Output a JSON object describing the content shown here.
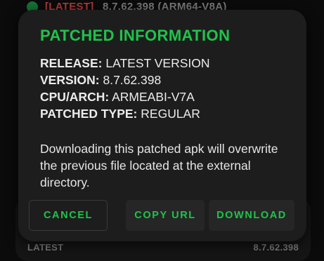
{
  "background": {
    "top_tag": "[LATEST]",
    "top_version": "8.7.62.398 (ARM64-V8A)",
    "bottom_left": "LATEST",
    "bottom_right": "8.7.62.398"
  },
  "dialog": {
    "title": "PATCHED INFORMATION",
    "release_key": "RELEASE:",
    "release_value": "LATEST VERSION",
    "version_key": "VERSION:",
    "version_value": "8.7.62.398",
    "arch_key": "CPU/ARCH:",
    "arch_value": "ARMEABI-V7A",
    "type_key": "PATCHED TYPE:",
    "type_value": "REGULAR",
    "description": "Downloading this patched apk will overwrite the previous file located at the external directory."
  },
  "buttons": {
    "cancel": "CANCEL",
    "copy_url": "COPY URL",
    "download": "DOWNLOAD"
  },
  "colors": {
    "accent": "#1ec44b",
    "dialog_bg": "#1d1d1d",
    "page_bg": "#0b0b0b"
  }
}
